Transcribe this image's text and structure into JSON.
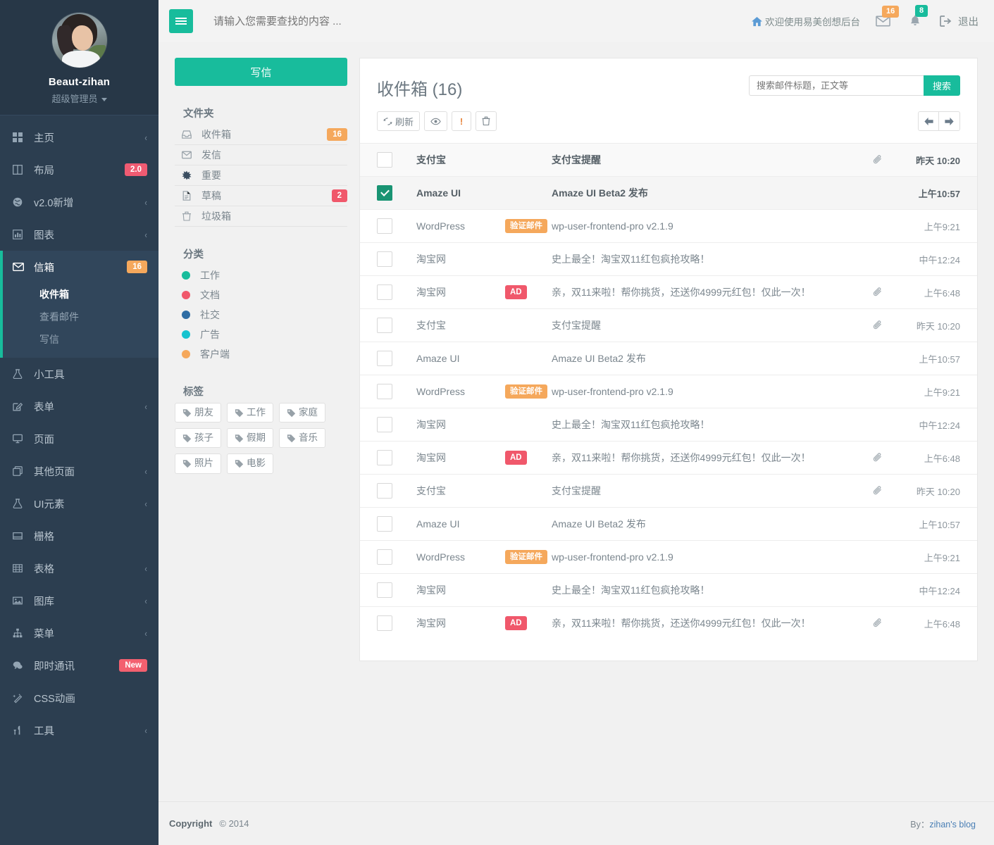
{
  "sidebar": {
    "user": {
      "name": "Beaut-zihan",
      "role": "超级管理员",
      "avatar_icon": "user-avatar"
    },
    "items": [
      {
        "label": "主页",
        "icon": "grid-icon",
        "chevron": "‹",
        "badge": null
      },
      {
        "label": "布局",
        "icon": "columns-icon",
        "chevron": null,
        "badge": "2.0",
        "badge_color": "#f05b72"
      },
      {
        "label": "v2.0新增",
        "icon": "globe-icon",
        "chevron": "‹",
        "badge": null
      },
      {
        "label": "图表",
        "icon": "chart-icon",
        "chevron": "‹",
        "badge": null
      },
      {
        "label": "信箱",
        "icon": "envelope-icon",
        "chevron": null,
        "badge": "16",
        "badge_color": "#f5a85c",
        "active": true
      },
      {
        "label": "小工具",
        "icon": "flask-icon",
        "chevron": null,
        "badge": null
      },
      {
        "label": "表单",
        "icon": "pencil-square-icon",
        "chevron": "‹",
        "badge": null
      },
      {
        "label": "页面",
        "icon": "desktop-icon",
        "chevron": null,
        "badge": null
      },
      {
        "label": "其他页面",
        "icon": "clone-icon",
        "chevron": "‹",
        "badge": null
      },
      {
        "label": "UI元素",
        "icon": "flask-icon",
        "chevron": "‹",
        "badge": null
      },
      {
        "label": "栅格",
        "icon": "grid-layout-icon",
        "chevron": null,
        "badge": null
      },
      {
        "label": "表格",
        "icon": "table-icon",
        "chevron": "‹",
        "badge": null
      },
      {
        "label": "图库",
        "icon": "image-icon",
        "chevron": "‹",
        "badge": null
      },
      {
        "label": "菜单",
        "icon": "sitemap-icon",
        "chevron": "‹",
        "badge": null
      },
      {
        "label": "即时通讯",
        "icon": "comments-icon",
        "chevron": null,
        "badge": "New",
        "badge_color": "#f3606f"
      },
      {
        "label": "CSS动画",
        "icon": "magic-icon",
        "chevron": null,
        "badge": null
      },
      {
        "label": "工具",
        "icon": "cutlery-icon",
        "chevron": "‹",
        "badge": null
      }
    ],
    "submenu": [
      {
        "label": "收件箱",
        "active": true
      },
      {
        "label": "查看邮件",
        "active": false
      },
      {
        "label": "写信",
        "active": false
      }
    ]
  },
  "topbar": {
    "menu_toggle_icon": "hamburger-icon",
    "search_placeholder": "请输入您需要查找的内容 ...",
    "search_value": "",
    "welcome_text": "欢迎使用易美创想后台",
    "home_icon": "home-icon",
    "mail_icon": "envelope-icon",
    "mail_count": "16",
    "bell_icon": "bell-icon",
    "bell_count": "8",
    "logout_icon": "sign-out-icon",
    "logout_label": "退出"
  },
  "mail_left": {
    "compose_label": "写信",
    "folders_title": "文件夹",
    "folders": [
      {
        "label": "收件箱",
        "icon": "inbox-icon",
        "badge": "16",
        "badge_color": "#f5a85c"
      },
      {
        "label": "发信",
        "icon": "envelope-o-icon",
        "badge": null
      },
      {
        "label": "重要",
        "icon": "asterisk-icon",
        "badge": null
      },
      {
        "label": "草稿",
        "icon": "file-text-icon",
        "badge": "2",
        "badge_color": "#f0586b"
      },
      {
        "label": "垃圾箱",
        "icon": "trash-icon",
        "badge": null
      }
    ],
    "categories_title": "分类",
    "categories": [
      {
        "label": "工作",
        "color": "#18bc9c"
      },
      {
        "label": "文档",
        "color": "#f0586b"
      },
      {
        "label": "社交",
        "color": "#2e6da4"
      },
      {
        "label": "广告",
        "color": "#17c3cf"
      },
      {
        "label": "客户端",
        "color": "#f5a85c"
      }
    ],
    "tags_title": "标签",
    "tags": [
      "朋友",
      "工作",
      "家庭",
      "孩子",
      "假期",
      "音乐",
      "照片",
      "电影"
    ],
    "tag_icon": "tag-icon"
  },
  "mail_panel": {
    "title": "收件箱 (16)",
    "search_placeholder": "搜索邮件标题，正文等",
    "search_value": "",
    "search_button": "搜索",
    "tools": [
      {
        "label": "刷新",
        "icon": "refresh-icon",
        "name": "refresh-button"
      },
      {
        "label": "",
        "icon": "eye-icon",
        "name": "mark-read-button"
      },
      {
        "label": "!",
        "icon": "exclamation-icon",
        "name": "mark-important-button"
      },
      {
        "label": "",
        "icon": "trash-icon",
        "name": "delete-button"
      }
    ],
    "pager": {
      "prev_icon": "arrow-left-icon",
      "next_icon": "arrow-right-icon"
    },
    "rows": [
      {
        "from": "支付宝",
        "label": null,
        "subject": "支付宝提醒",
        "attachment": true,
        "time": "昨天 10:20",
        "checked": false,
        "unread": true,
        "shade": "alt"
      },
      {
        "from": "Amaze UI",
        "label": null,
        "subject": "Amaze UI Beta2 发布",
        "attachment": false,
        "time": "上午10:57",
        "checked": true,
        "unread": true,
        "shade": "sel"
      },
      {
        "from": "WordPress",
        "label": "验证邮件",
        "label_color": "orange",
        "subject": "wp-user-frontend-pro v2.1.9",
        "attachment": false,
        "time": "上午9:21",
        "checked": false,
        "unread": false,
        "shade": "none"
      },
      {
        "from": "淘宝网",
        "label": null,
        "subject": "史上最全！淘宝双11红包疯抢攻略！",
        "attachment": false,
        "time": "中午12:24",
        "checked": false,
        "unread": false,
        "shade": "none"
      },
      {
        "from": "淘宝网",
        "label": "AD",
        "label_color": "red",
        "subject": "亲，双11来啦！帮你挑货，还送你4999元红包！仅此一次！",
        "attachment": true,
        "time": "上午6:48",
        "checked": false,
        "unread": false,
        "shade": "none"
      },
      {
        "from": "支付宝",
        "label": null,
        "subject": "支付宝提醒",
        "attachment": true,
        "time": "昨天 10:20",
        "checked": false,
        "unread": false,
        "shade": "none"
      },
      {
        "from": "Amaze UI",
        "label": null,
        "subject": "Amaze UI Beta2 发布",
        "attachment": false,
        "time": "上午10:57",
        "checked": false,
        "unread": false,
        "shade": "none"
      },
      {
        "from": "WordPress",
        "label": "验证邮件",
        "label_color": "orange",
        "subject": "wp-user-frontend-pro v2.1.9",
        "attachment": false,
        "time": "上午9:21",
        "checked": false,
        "unread": false,
        "shade": "none"
      },
      {
        "from": "淘宝网",
        "label": null,
        "subject": "史上最全！淘宝双11红包疯抢攻略！",
        "attachment": false,
        "time": "中午12:24",
        "checked": false,
        "unread": false,
        "shade": "none"
      },
      {
        "from": "淘宝网",
        "label": "AD",
        "label_color": "red",
        "subject": "亲，双11来啦！帮你挑货，还送你4999元红包！仅此一次！",
        "attachment": true,
        "time": "上午6:48",
        "checked": false,
        "unread": false,
        "shade": "none"
      },
      {
        "from": "支付宝",
        "label": null,
        "subject": "支付宝提醒",
        "attachment": true,
        "time": "昨天 10:20",
        "checked": false,
        "unread": false,
        "shade": "none"
      },
      {
        "from": "Amaze UI",
        "label": null,
        "subject": "Amaze UI Beta2 发布",
        "attachment": false,
        "time": "上午10:57",
        "checked": false,
        "unread": false,
        "shade": "none"
      },
      {
        "from": "WordPress",
        "label": "验证邮件",
        "label_color": "orange",
        "subject": "wp-user-frontend-pro v2.1.9",
        "attachment": false,
        "time": "上午9:21",
        "checked": false,
        "unread": false,
        "shade": "none"
      },
      {
        "from": "淘宝网",
        "label": null,
        "subject": "史上最全！淘宝双11红包疯抢攻略！",
        "attachment": false,
        "time": "中午12:24",
        "checked": false,
        "unread": false,
        "shade": "none"
      },
      {
        "from": "淘宝网",
        "label": "AD",
        "label_color": "red",
        "subject": "亲，双11来啦！帮你挑货，还送你4999元红包！仅此一次！",
        "attachment": true,
        "time": "上午6:48",
        "checked": false,
        "unread": false,
        "shade": "none"
      }
    ]
  },
  "footer": {
    "copyright_label": "Copyright",
    "copyright_year": "© 2014",
    "by_label": "By：",
    "by_link": "zihan's blog"
  },
  "colors": {
    "accent": "#18bc9c",
    "sidebar_bg": "#2c3e50",
    "sidebar_active": "#31465b",
    "badge_orange": "#f5a85c",
    "badge_red": "#f0586b",
    "page_bg": "#f1f1f1"
  }
}
